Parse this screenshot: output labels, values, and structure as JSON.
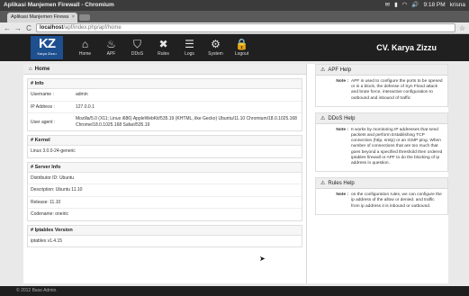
{
  "os": {
    "window_title": "Aplikasi Manjemen Firewall - Chromium",
    "time": "9:18 PM",
    "user": "krisna"
  },
  "browser": {
    "tab_title": "Aplikasi Manjemen Firewa",
    "tab_close": "×",
    "url_host": "localhost",
    "url_path": "/apf/index.php/apf/home",
    "back": "←",
    "forward": "→",
    "reload": "C",
    "star": "☆"
  },
  "app": {
    "logo_main": "KZ",
    "logo_sub": "Karya Zizzu",
    "company": "CV. Karya Zizzu",
    "nav": [
      {
        "label": "Home",
        "icon": "home-icon",
        "glyph": "⌂"
      },
      {
        "label": "APF",
        "icon": "fire-icon",
        "glyph": "♨"
      },
      {
        "label": "DDoS",
        "icon": "shield-icon",
        "glyph": "⛉"
      },
      {
        "label": "Rules",
        "icon": "tools-icon",
        "glyph": "✖"
      },
      {
        "label": "Logs",
        "icon": "list-icon",
        "glyph": "☰"
      },
      {
        "label": "System",
        "icon": "gears-icon",
        "glyph": "⚙"
      },
      {
        "label": "Logout",
        "icon": "lock-icon",
        "glyph": "🔒"
      }
    ]
  },
  "home": {
    "title": "Home",
    "info": {
      "title": "# Info",
      "username_label": "Username  :",
      "username": "admin",
      "ip_label": "IP Address  :",
      "ip": "127.0.0.1",
      "agent_label": "User agent  :",
      "agent": "Mozilla/5.0 (X11; Linux i686) AppleWebKit/535.19 (KHTML, like Gecko) Ubuntu/11.10 Chromium/18.0.1025.168 Chrome/18.0.1025.168 Safari/535.19"
    },
    "kernel": {
      "title": "# Kernel",
      "value": "Linux 3.0.0-24-generic"
    },
    "server": {
      "title": "# Server Info",
      "distributor": "Distributor ID: Ubuntu",
      "description": "Description: Ubuntu 11.10",
      "release": "Release: 11.10",
      "codename": "Codename: oneiric"
    },
    "iptables": {
      "title": "# Iptables Version",
      "value": "iptables v1.4.15"
    }
  },
  "help": [
    {
      "title": "APF Help",
      "note": "Note :",
      "text": "APF is used to configure the ports to be opened or in a block, the defense of Syn Flood attack and brute force, interactive configuration to outbound and inbound of traffic"
    },
    {
      "title": "DDoS Help",
      "note": "Note :",
      "text": "It works by monitoring IP addresses that send packets and perform Establishing TCP connection (http, smtp) or an ICMP ping. When number of connections that are too much that goes beyond a specified threshold then ordered iptables firewall or APF to do the blocking of ip address in question."
    },
    {
      "title": "Rules Help",
      "note": "Note :",
      "text": "on the configuration rules, we can configure the ip address of the allow or denied. and traffic from ip address it is inbound or outbound."
    }
  ],
  "footer": {
    "copyright": "© 2012 Base Admin."
  }
}
